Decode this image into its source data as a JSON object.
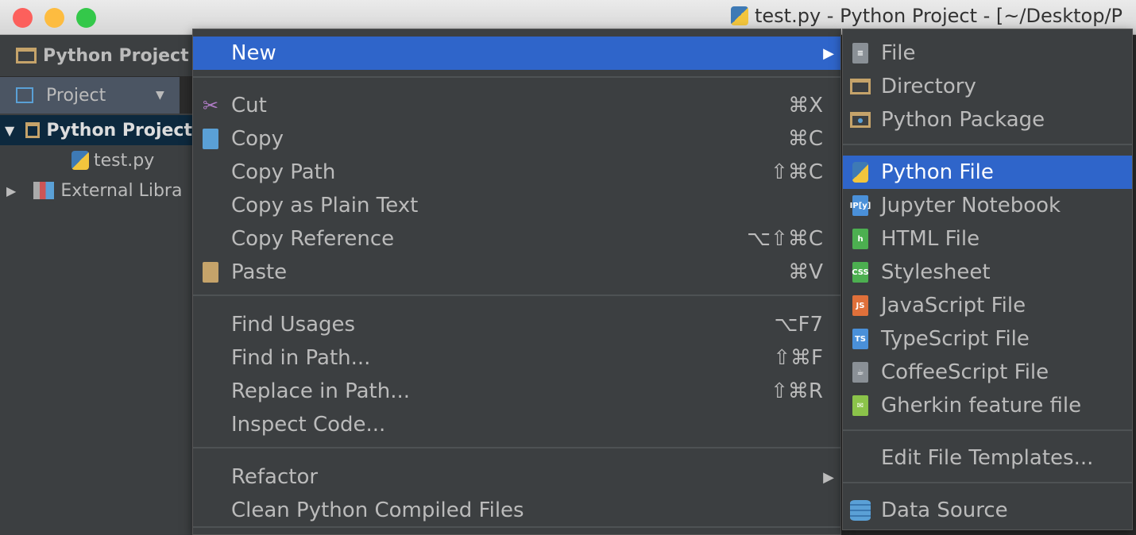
{
  "window": {
    "title": "test.py - Python Project - [~/Desktop/P"
  },
  "nav": {
    "project": "Python Project"
  },
  "toolbar": {
    "view": "Project"
  },
  "tree": [
    {
      "label": "Python Project",
      "icon": "folder-icon"
    },
    {
      "label": "test.py",
      "icon": "python-file-icon"
    },
    {
      "label": "External Libra",
      "icon": "library-icon"
    }
  ],
  "menu": {
    "new": "New",
    "items": [
      {
        "label": "Cut",
        "shortcut": "⌘X",
        "icon": "scissors-icon"
      },
      {
        "label": "Copy",
        "shortcut": "⌘C",
        "icon": "copy-icon"
      },
      {
        "label": "Copy Path",
        "shortcut": "⇧⌘C"
      },
      {
        "label": "Copy as Plain Text",
        "shortcut": ""
      },
      {
        "label": "Copy Reference",
        "shortcut": "⌥⇧⌘C"
      },
      {
        "label": "Paste",
        "shortcut": "⌘V",
        "icon": "paste-icon"
      },
      {
        "label": "Find Usages",
        "shortcut": "⌥F7"
      },
      {
        "label": "Find in Path...",
        "shortcut": "⇧⌘F"
      },
      {
        "label": "Replace in Path...",
        "shortcut": "⇧⌘R"
      },
      {
        "label": "Inspect Code...",
        "shortcut": ""
      },
      {
        "label": "Refactor",
        "shortcut": ""
      },
      {
        "label": "Clean Python Compiled Files",
        "shortcut": ""
      }
    ]
  },
  "submenu": {
    "items": [
      {
        "label": "File",
        "badge": "≡",
        "color": "#8a9096"
      },
      {
        "label": "Directory",
        "badge": "",
        "color": "#c5a36a"
      },
      {
        "label": "Python Package",
        "badge": "",
        "color": "#c5a36a"
      },
      {
        "label": "Python File",
        "badge": "",
        "color": "#3e7ab5"
      },
      {
        "label": "Jupyter Notebook",
        "badge": "IP[y]",
        "color": "#4a90d9"
      },
      {
        "label": "HTML File",
        "badge": "h",
        "color": "#4caf50"
      },
      {
        "label": "Stylesheet",
        "badge": "CSS",
        "color": "#4caf50"
      },
      {
        "label": "JavaScript File",
        "badge": "JS",
        "color": "#e0703a"
      },
      {
        "label": "TypeScript File",
        "badge": "TS",
        "color": "#4a90d9"
      },
      {
        "label": "CoffeeScript File",
        "badge": "☕",
        "color": "#8a9096"
      },
      {
        "label": "Gherkin feature file",
        "badge": "✉",
        "color": "#8bc34a"
      },
      {
        "label": "Edit File Templates...",
        "badge": "",
        "color": ""
      },
      {
        "label": "Data Source",
        "badge": "",
        "color": "#5aa0d6"
      }
    ],
    "selected": "Python File"
  },
  "colors": {
    "highlight": "#2f65ca",
    "menu_bg": "#3c3f41"
  }
}
